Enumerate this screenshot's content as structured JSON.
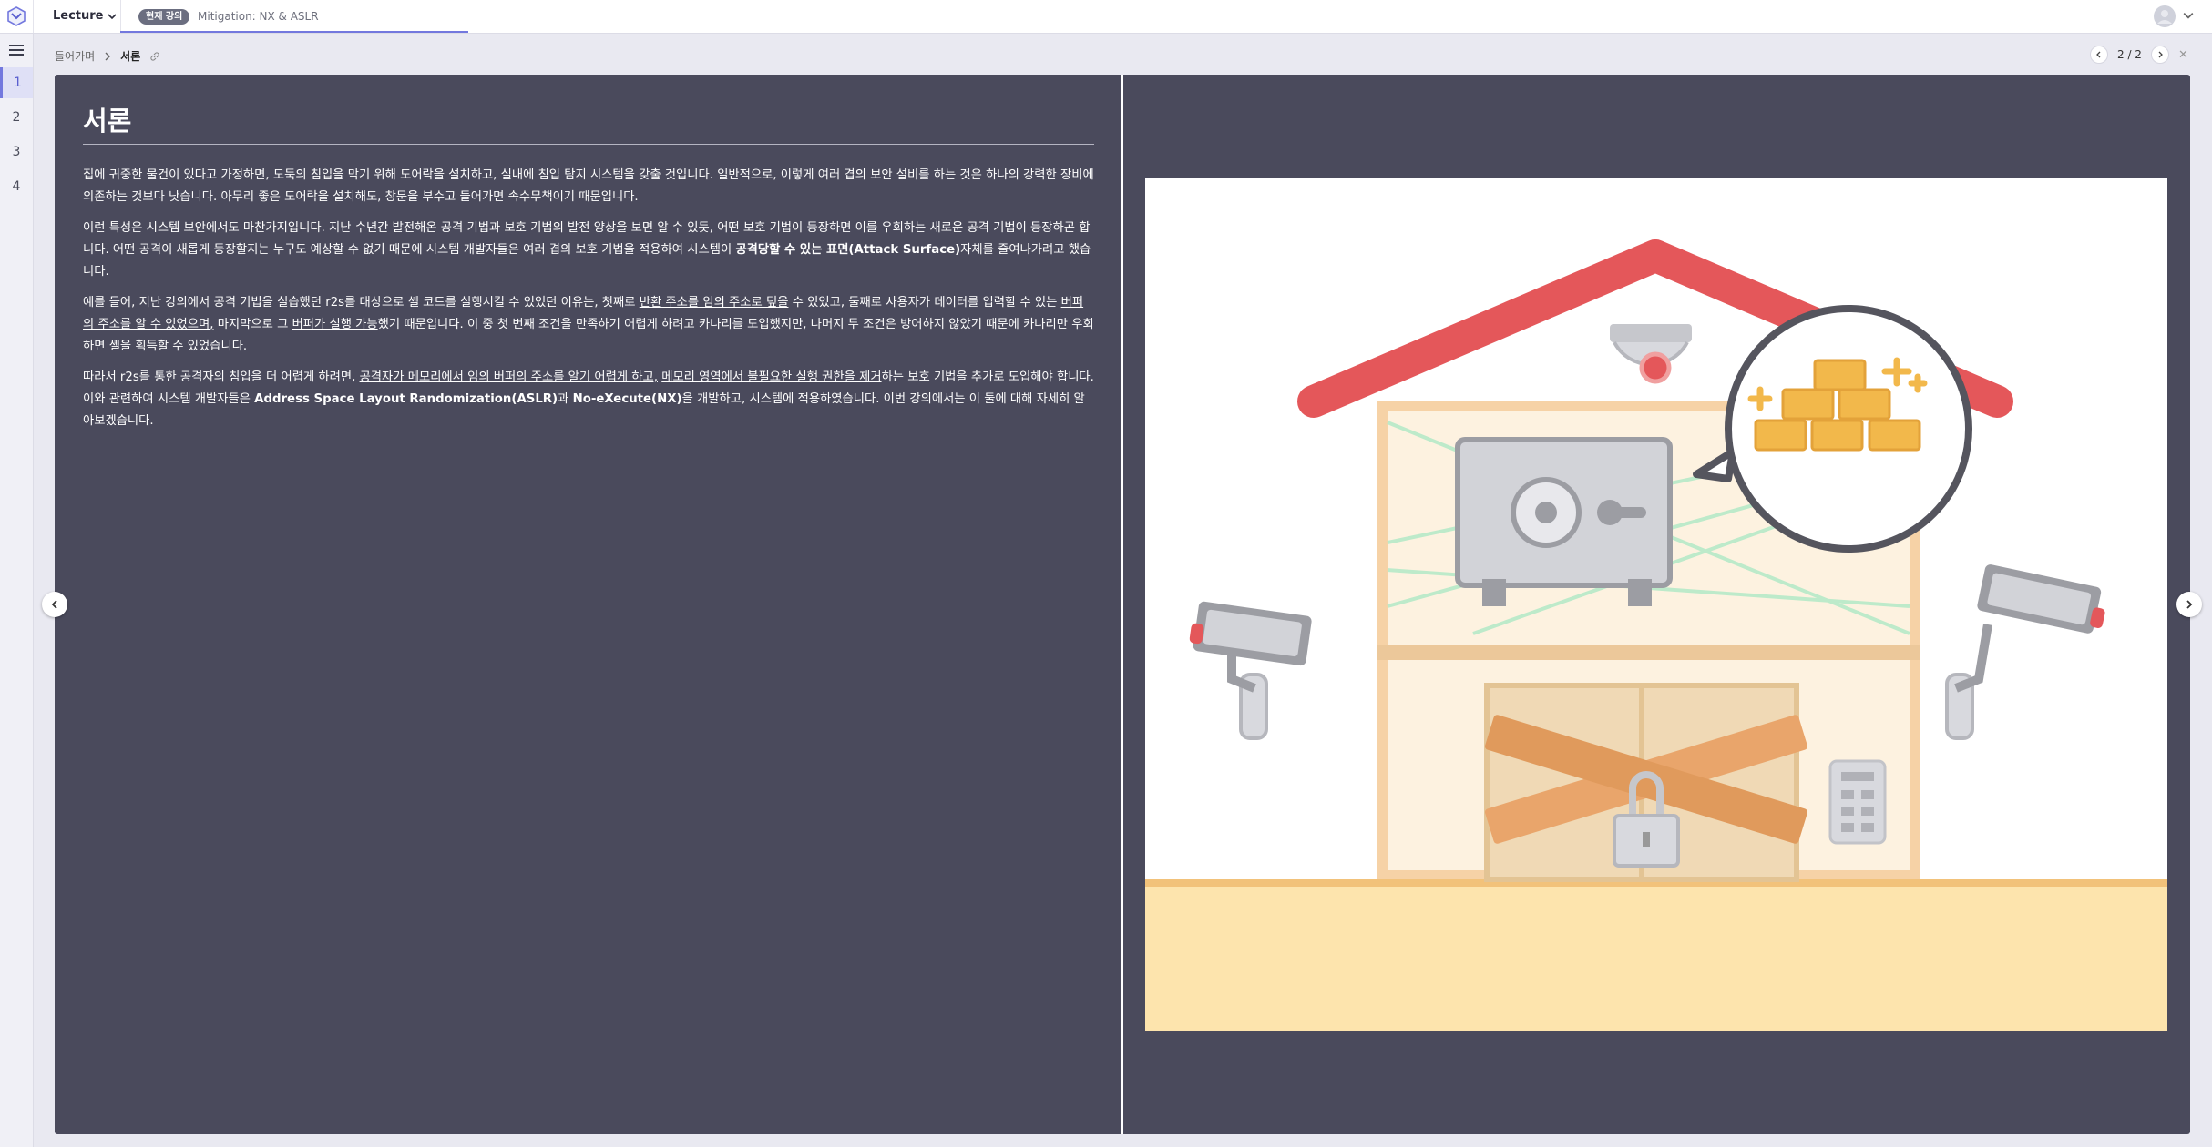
{
  "header": {
    "lecture_dropdown": "Lecture",
    "current_badge": "현재 강의",
    "lecture_title": "Mitigation: NX & ASLR"
  },
  "sidebar": {
    "items": [
      "1",
      "2",
      "3",
      "4"
    ],
    "active_index": 0
  },
  "breadcrumb": {
    "parent": "들어가며",
    "current": "서론"
  },
  "pager": {
    "label": "2 / 2"
  },
  "slide": {
    "title": "서론",
    "p1": "집에 귀중한 물건이 있다고 가정하면, 도둑의 침입을 막기 위해 도어락을 설치하고, 실내에 침입 탐지 시스템을 갖출 것입니다. 일반적으로, 이렇게 여러 겹의 보안 설비를 하는 것은 하나의 강력한 장비에 의존하는 것보다 낫습니다. 아무리 좋은 도어락을 설치해도, 창문을 부수고 들어가면 속수무책이기 때문입니다.",
    "p2_a": "이런 특성은 시스템 보안에서도 마찬가지입니다. 지난 수년간 발전해온 공격 기법과 보호 기법의 발전 양상을 보면 알 수 있듯, 어떤 보호 기법이 등장하면 이를 우회하는 새로운 공격 기법이 등장하곤 합니다. 어떤 공격이 새롭게 등장할지는 누구도 예상할 수 없기 때문에 시스템 개발자들은 여러 겹의 보호 기법을 적용하여 시스템이 ",
    "p2_b": "공격당할 수 있는 표면(Attack Surface)",
    "p2_c": "자체를 줄여나가려고 했습니다.",
    "p3_a": "예를 들어, 지난 강의에서 공격 기법을 실습했던 r2s를 대상으로 셸 코드를 실행시킬 수 있었던 이유는, 첫째로 ",
    "p3_u1": "반환 주소를 임의 주소로 덮을",
    "p3_b": " 수 있었고, 둘째로 사용자가 데이터를 입력할 수 있는 ",
    "p3_u2": "버퍼의 주소를 알 수 있었으며,",
    "p3_c": " 마지막으로 그 ",
    "p3_u3": "버퍼가 실행 가능",
    "p3_d": "했기 때문입니다. 이 중 첫 번째 조건을 만족하기 어렵게 하려고 카나리를 도입했지만, 나머지 두 조건은 방어하지 않았기 때문에 카나리만 우회하면 셸을 획득할 수 있었습니다.",
    "p4_a": "따라서 r2s를 통한 공격자의 침입을 더 어렵게 하려면, ",
    "p4_u1": "공격자가 메모리에서 임의 버퍼의 주소를 알기 어렵게 하고,",
    "p4_b": " ",
    "p4_u2": "메모리 영역에서 불필요한 실행 권한을 제거",
    "p4_c": "하는 보호 기법을 추가로 도입해야 합니다. 이와 관련하여 시스템 개발자들은 ",
    "p4_bold1": "Address Space Layout Randomization(ASLR)",
    "p4_d": "과 ",
    "p4_bold2": "No-eXecute(NX)",
    "p4_e": "을 개발하고, 시스템에 적용하였습니다. 이번 강의에서는 이 둘에 대해 자세히 알아보겠습니다."
  },
  "colors": {
    "accent": "#7378de",
    "slide_bg": "#4a4a5c",
    "roof": "#e4575a",
    "gold": "#f2b84b",
    "floor": "#fde4ad"
  },
  "icons": [
    "logo-icon",
    "chevron-down-icon",
    "menu-icon",
    "chevron-right-icon",
    "link-icon",
    "chevron-left-icon",
    "close-icon",
    "house-security-illustration"
  ]
}
